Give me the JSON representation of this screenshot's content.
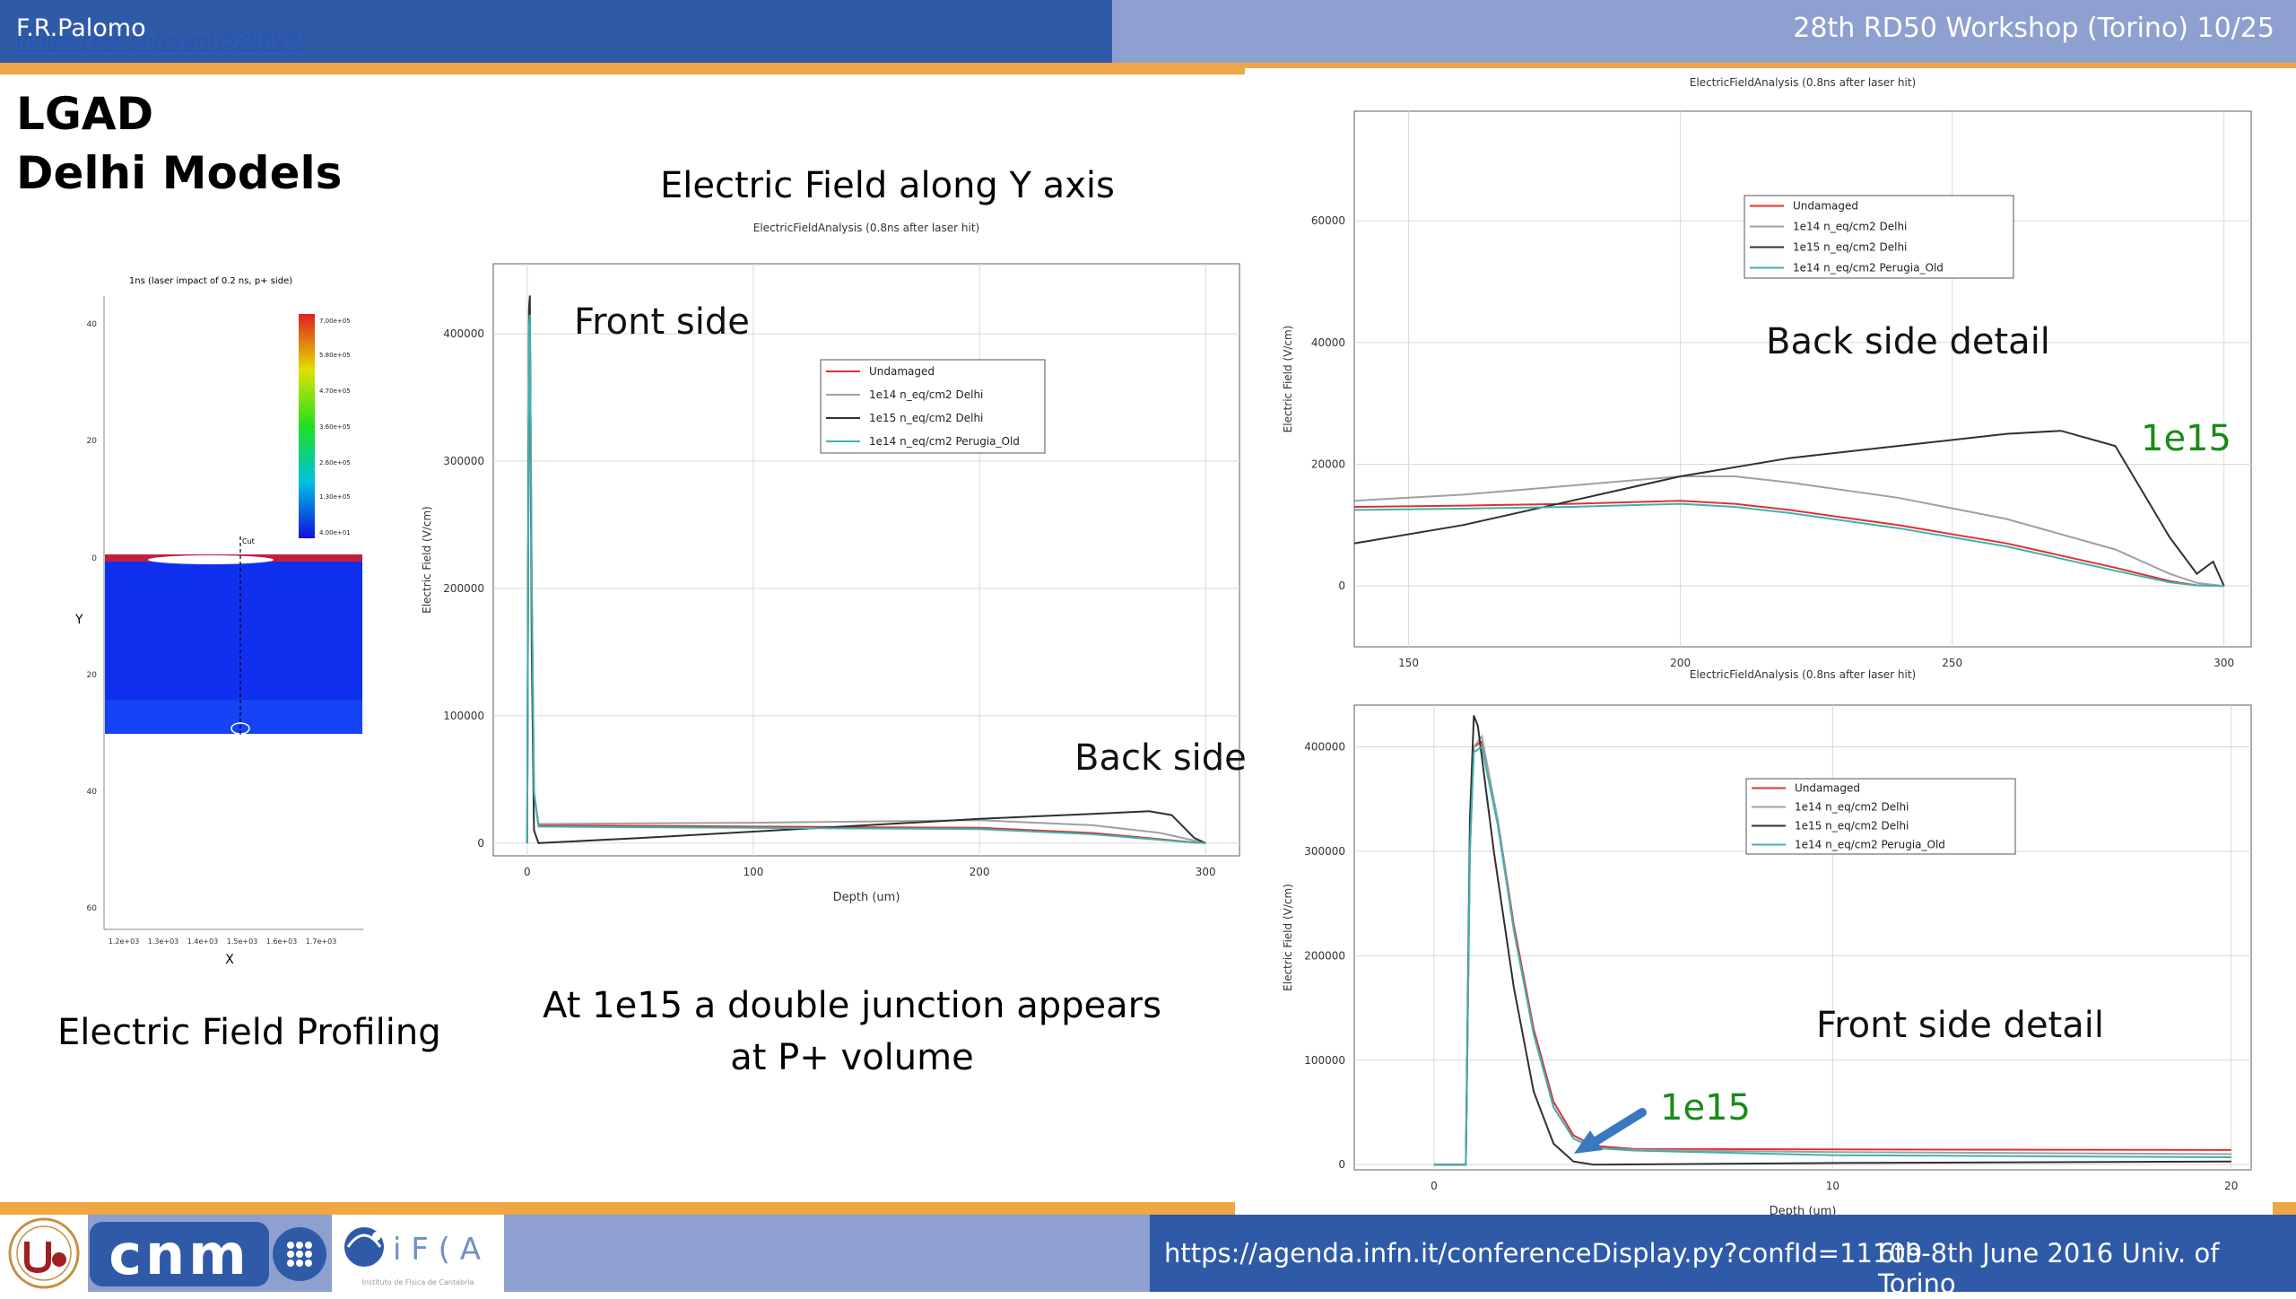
{
  "header": {
    "author": "F.R.Palomo",
    "link": "indico.cern.ch/event/539093/",
    "workshop": "28th RD50 Workshop (Torino) 10/25"
  },
  "title": {
    "line1": "LGAD",
    "line2": "Delhi Models"
  },
  "section_title": "Electric Field along Y axis",
  "captions": {
    "profiling": "Electric Field Profiling",
    "junction_line1": "At 1e15 a double junction appears",
    "junction_line2": "at P+ volume"
  },
  "footer": {
    "url": "https://agenda.infn.it/conferenceDisplay.py?confId=11109",
    "event": "6th-8th June  2016  Univ. of Torino",
    "logo_cnm": "cnm",
    "logo_ifca": "i F ( A",
    "logo_ifca_sub": "Instituto de Física de Cantabria"
  },
  "simulation_map": {
    "title": "1ns (laser impact of 0.2 ns, p+ side)",
    "x_label": "X",
    "y_label": "Y",
    "y_ticks": [
      "40",
      "20",
      "0",
      "20",
      "40",
      "60"
    ],
    "x_ticks": [
      "1.2e+03",
      "1.3e+03",
      "1.4e+03",
      "1.5e+03",
      "1.6e+03",
      "1.7e+03"
    ],
    "colorbar_labels": [
      "7.00e+05",
      "5.80e+05",
      "4.70e+05",
      "3.60e+05",
      "2.60e+05",
      "1.30e+05",
      "4.00e+01"
    ],
    "marker": "Cut"
  },
  "chart_data": [
    {
      "id": "main",
      "type": "line",
      "title": "ElectricFieldAnalysis (0.8ns after laser hit)",
      "xlabel": "Depth (um)",
      "ylabel": "Electric Field (V/cm)",
      "xlim": [
        -15,
        315
      ],
      "ylim": [
        -10000,
        455000
      ],
      "x_ticks": [
        0,
        100,
        200,
        300
      ],
      "y_ticks": [
        0,
        100000,
        200000,
        300000,
        400000
      ],
      "grid": true,
      "legend": "top-center",
      "annotations": [
        "Front side",
        "Back side"
      ],
      "series": [
        {
          "name": "Undamaged",
          "color": "#e03030",
          "x": [
            0,
            0.8,
            1.2,
            2,
            3,
            5,
            50,
            100,
            150,
            200,
            250,
            280,
            295,
            300
          ],
          "y": [
            0,
            400000,
            410000,
            200000,
            40000,
            14000,
            13500,
            13000,
            12500,
            12000,
            8000,
            3000,
            500,
            0
          ]
        },
        {
          "name": "1e14 n_eq/cm2 Delhi",
          "color": "#a0a0a0",
          "x": [
            0,
            0.8,
            1.2,
            2,
            3,
            5,
            50,
            100,
            150,
            200,
            250,
            280,
            295,
            300
          ],
          "y": [
            0,
            400000,
            410000,
            200000,
            40000,
            15000,
            15500,
            16000,
            17000,
            18000,
            14000,
            8000,
            2000,
            0
          ]
        },
        {
          "name": "1e15 n_eq/cm2 Delhi",
          "color": "#303030",
          "x": [
            0,
            0.8,
            1.2,
            2,
            3,
            5,
            50,
            100,
            150,
            200,
            250,
            275,
            285,
            295,
            300
          ],
          "y": [
            0,
            420000,
            430000,
            150000,
            10000,
            0,
            4000,
            9000,
            14000,
            19000,
            23000,
            25000,
            22000,
            4000,
            0
          ]
        },
        {
          "name": "1e14 n_eq/cm2 Perugia_Old",
          "color": "#40b0b0",
          "x": [
            0,
            0.8,
            1.2,
            2,
            3,
            5,
            50,
            100,
            150,
            200,
            250,
            280,
            295,
            300
          ],
          "y": [
            0,
            405000,
            415000,
            200000,
            40000,
            13000,
            12500,
            12000,
            11500,
            11000,
            7000,
            2500,
            400,
            0
          ]
        }
      ]
    },
    {
      "id": "back",
      "type": "line",
      "title": "ElectricFieldAnalysis (0.8ns after laser hit)",
      "xlabel": "",
      "ylabel": "Electric Field (V/cm)",
      "xlim": [
        140,
        305
      ],
      "ylim": [
        -10000,
        78000
      ],
      "x_ticks": [
        150,
        200,
        250,
        300
      ],
      "y_ticks": [
        0,
        20000,
        40000,
        60000
      ],
      "grid": true,
      "legend": "top-center",
      "annotations": [
        "Back side detail",
        "1e15"
      ],
      "series": [
        {
          "name": "Undamaged",
          "color": "#e03030",
          "x": [
            140,
            160,
            180,
            200,
            210,
            220,
            240,
            260,
            280,
            290,
            295,
            300
          ],
          "y": [
            13000,
            13200,
            13500,
            14000,
            13500,
            12500,
            10000,
            7000,
            3000,
            800,
            100,
            0
          ]
        },
        {
          "name": "1e14 n_eq/cm2 Delhi",
          "color": "#a0a0a0",
          "x": [
            140,
            160,
            180,
            200,
            210,
            220,
            240,
            260,
            280,
            290,
            295,
            300
          ],
          "y": [
            14000,
            15000,
            16500,
            18000,
            18000,
            17000,
            14500,
            11000,
            6000,
            2000,
            500,
            0
          ]
        },
        {
          "name": "1e15 n_eq/cm2 Delhi",
          "color": "#303030",
          "x": [
            140,
            160,
            180,
            200,
            220,
            240,
            260,
            270,
            280,
            290,
            295,
            298,
            300
          ],
          "y": [
            7000,
            10000,
            14000,
            18000,
            21000,
            23000,
            25000,
            25500,
            23000,
            8000,
            2000,
            4000,
            0
          ]
        },
        {
          "name": "1e14 n_eq/cm2 Perugia_Old",
          "color": "#40b0b0",
          "x": [
            140,
            160,
            180,
            200,
            210,
            220,
            240,
            260,
            280,
            290,
            295,
            300
          ],
          "y": [
            12500,
            12700,
            13000,
            13500,
            13000,
            12000,
            9500,
            6500,
            2500,
            600,
            100,
            0
          ]
        }
      ]
    },
    {
      "id": "front",
      "type": "line",
      "title": "ElectricFieldAnalysis (0.8ns after laser hit)",
      "xlabel": "Depth (um)",
      "ylabel": "Electric Field (V/cm)",
      "xlim": [
        -2,
        20.5
      ],
      "ylim": [
        -5000,
        440000
      ],
      "x_ticks": [
        0,
        10,
        20
      ],
      "y_ticks": [
        0,
        100000,
        200000,
        300000,
        400000
      ],
      "grid": true,
      "legend": "top-center",
      "annotations": [
        "Front side detail",
        "1e15"
      ],
      "series": [
        {
          "name": "Undamaged",
          "color": "#e03030",
          "x": [
            0,
            0.8,
            0.9,
            1,
            1.2,
            1.6,
            2,
            2.5,
            3,
            3.5,
            4,
            5,
            10,
            20
          ],
          "y": [
            0,
            0,
            300000,
            400000,
            405000,
            330000,
            230000,
            130000,
            60000,
            28000,
            18000,
            15000,
            14500,
            14000
          ]
        },
        {
          "name": "1e14 n_eq/cm2 Delhi",
          "color": "#a0a0a0",
          "x": [
            0,
            0.8,
            0.9,
            1,
            1.2,
            1.6,
            2,
            2.5,
            3,
            3.5,
            4,
            5,
            10,
            20
          ],
          "y": [
            0,
            0,
            300000,
            400000,
            410000,
            330000,
            225000,
            125000,
            55000,
            25000,
            16000,
            14000,
            12000,
            10000
          ]
        },
        {
          "name": "1e15 n_eq/cm2 Delhi",
          "color": "#303030",
          "x": [
            0,
            0.8,
            0.9,
            1,
            1.1,
            1.5,
            2,
            2.5,
            3,
            3.5,
            4,
            10,
            20
          ],
          "y": [
            0,
            0,
            330000,
            430000,
            420000,
            300000,
            170000,
            70000,
            20000,
            3000,
            0,
            1500,
            3000
          ]
        },
        {
          "name": "1e14 n_eq/cm2 Perugia_Old",
          "color": "#40b0b0",
          "x": [
            0,
            0.8,
            0.9,
            1,
            1.2,
            1.6,
            2,
            2.5,
            3,
            3.5,
            4,
            5,
            10,
            20
          ],
          "y": [
            0,
            0,
            300000,
            395000,
            400000,
            325000,
            225000,
            125000,
            55000,
            25000,
            16000,
            13500,
            9000,
            7000
          ]
        }
      ]
    }
  ]
}
